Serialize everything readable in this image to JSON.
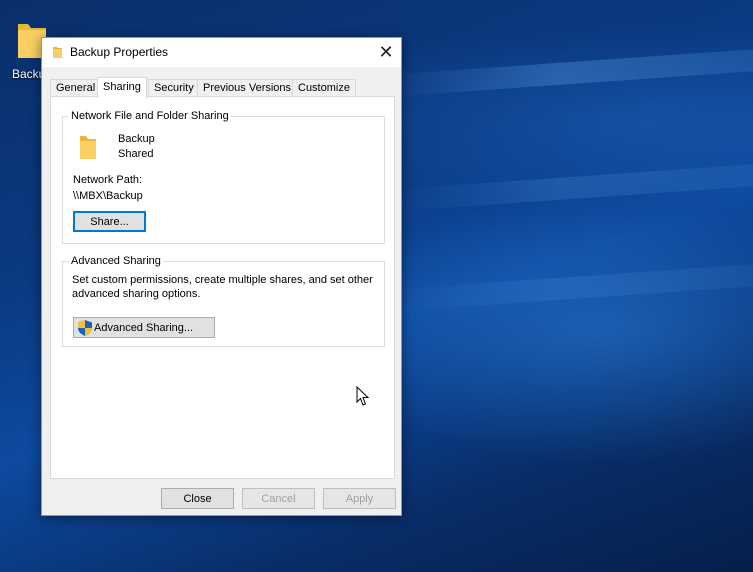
{
  "desktop": {
    "icon_label": "Backup"
  },
  "dialog": {
    "title": "Backup Properties",
    "close_glyph": "✕",
    "tabs": [
      {
        "label": "General"
      },
      {
        "label": "Sharing",
        "active": true
      },
      {
        "label": "Security"
      },
      {
        "label": "Previous Versions"
      },
      {
        "label": "Customize"
      }
    ]
  },
  "network_sharing": {
    "group_title": "Network File and Folder Sharing",
    "folder_name": "Backup",
    "status": "Shared",
    "network_path_label": "Network Path:",
    "network_path": "\\\\MBX\\Backup",
    "share_button": "Share..."
  },
  "advanced_sharing": {
    "group_title": "Advanced Sharing",
    "description": "Set custom permissions, create multiple shares, and set other advanced sharing options.",
    "button": "Advanced Sharing..."
  },
  "footer": {
    "close": "Close",
    "cancel": "Cancel",
    "apply": "Apply"
  },
  "colors": {
    "accent": "#0078d7",
    "folder_yellow": "#f8c94a",
    "desktop_blue": "#0b3a82"
  }
}
